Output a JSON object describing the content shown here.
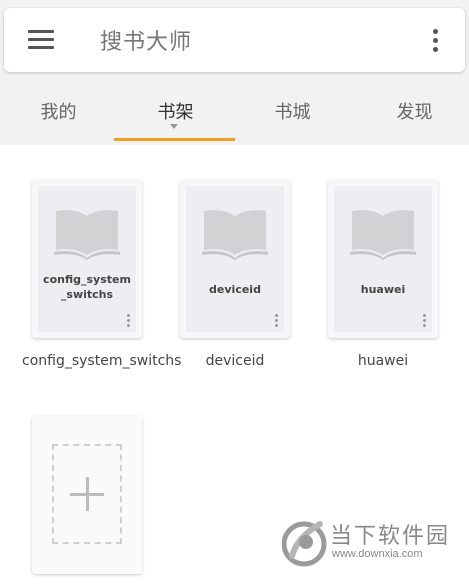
{
  "header": {
    "title": "搜书大师",
    "menu_icon": "hamburger-menu-icon",
    "more_icon": "more-vertical-icon"
  },
  "tabs": [
    {
      "label": "我的",
      "active": false
    },
    {
      "label": "书架",
      "active": true
    },
    {
      "label": "书城",
      "active": false
    },
    {
      "label": "发现",
      "active": false
    }
  ],
  "colors": {
    "accent": "#f0a01e",
    "background": "#f2f2f2"
  },
  "books": [
    {
      "cover_title": "config_system_switchs",
      "caption": "config_system_switchs"
    },
    {
      "cover_title": "deviceid",
      "caption": "deviceid"
    },
    {
      "cover_title": "huawei",
      "caption": "huawei"
    }
  ],
  "watermark": {
    "name": "当下软件园",
    "url": "www.downxia.com"
  }
}
